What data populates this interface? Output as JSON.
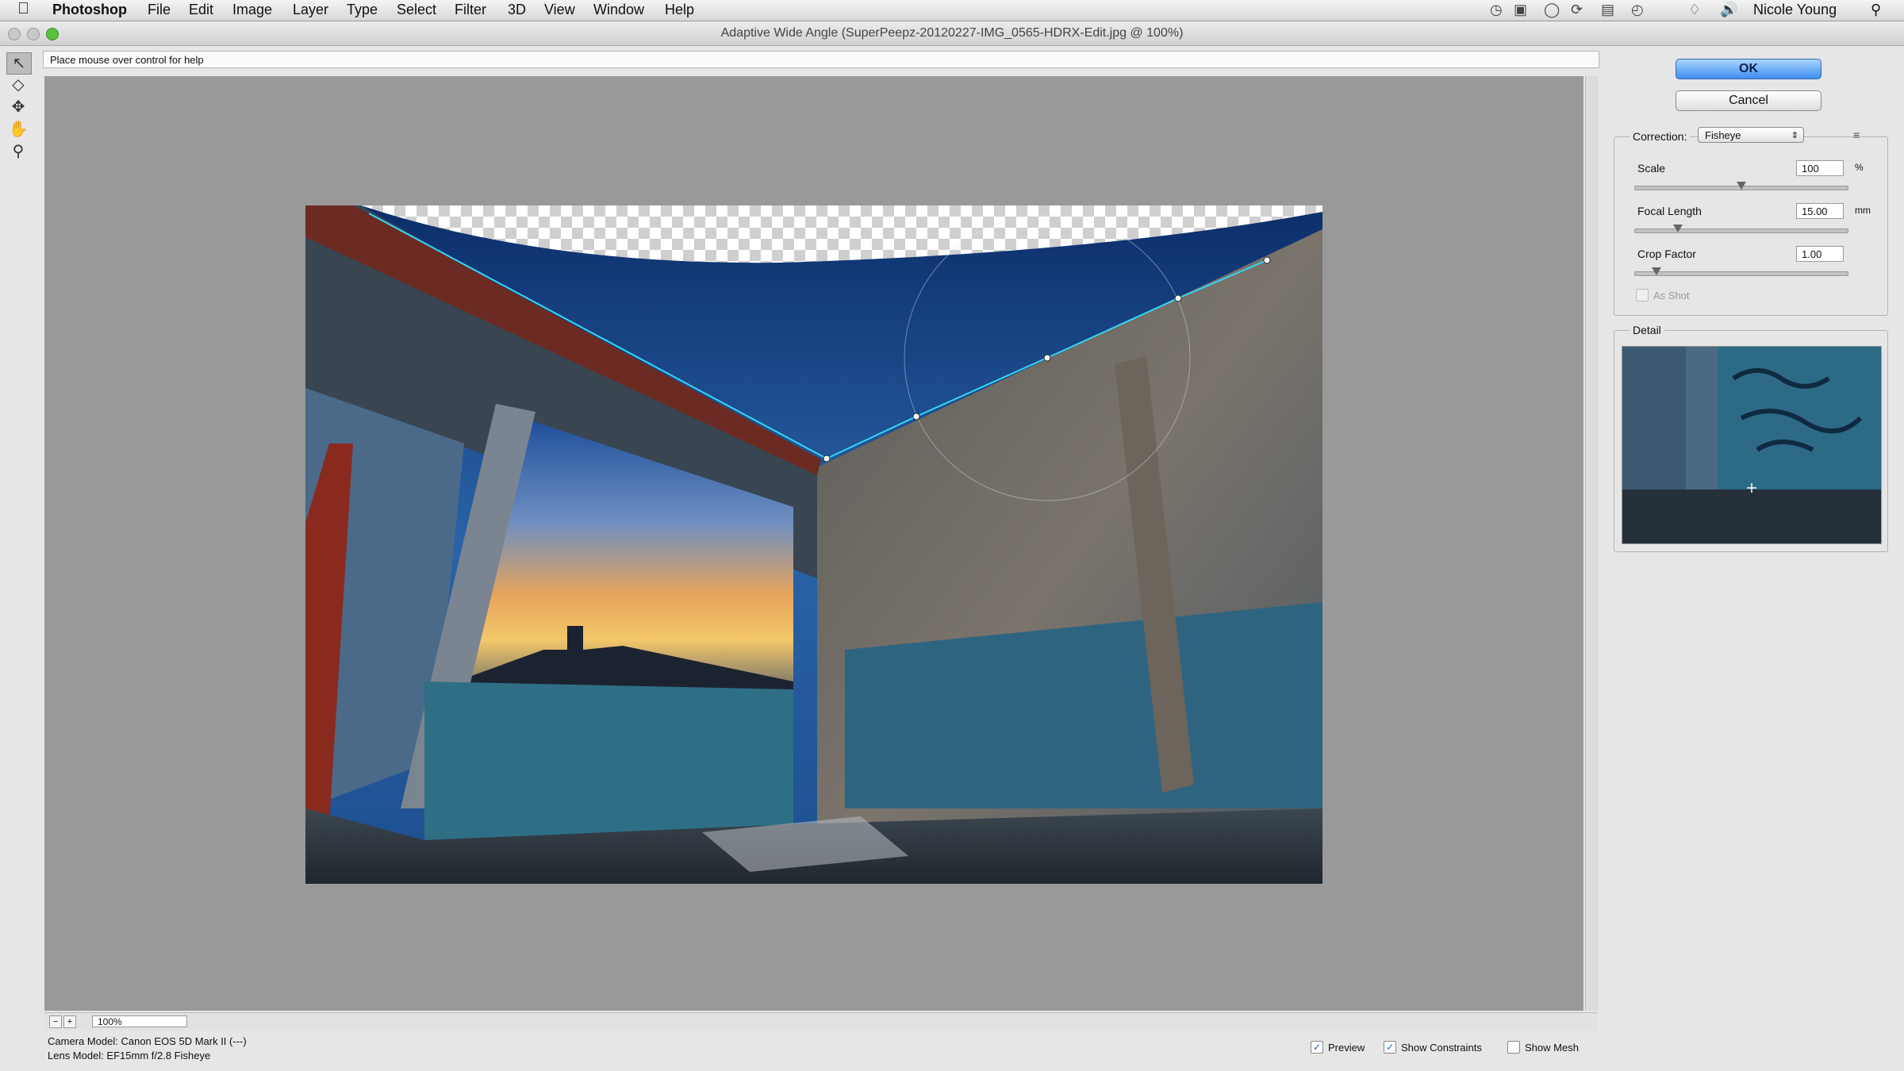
{
  "menubar": {
    "apple": "",
    "app_name": "Photoshop",
    "items": [
      "File",
      "Edit",
      "Image",
      "Layer",
      "Type",
      "Select",
      "Filter",
      "3D",
      "View",
      "Window",
      "Help"
    ],
    "user": "Nicole Young",
    "status_icons": [
      "clock-icon",
      "display-icon",
      "sync-icon",
      "timemachine-icon",
      "wifi-icon",
      "volume-icon",
      "spotlight-icon"
    ]
  },
  "window": {
    "title": "Adaptive Wide Angle (SuperPeepz-20120227-IMG_0565-HDRX-Edit.jpg @ 100%)"
  },
  "help_text": "Place mouse over control for help",
  "tools": [
    "constraint-tool-icon",
    "polygon-constraint-tool-icon",
    "move-tool-icon",
    "hand-tool-icon",
    "zoom-tool-icon"
  ],
  "zoom": {
    "value": "100%"
  },
  "camera_info": {
    "camera": "Camera Model: Canon EOS 5D Mark II (---)",
    "lens": "Lens Model: EF15mm f/2.8 Fisheye"
  },
  "options": {
    "preview": "Preview",
    "preview_checked": true,
    "show_constraints": "Show Constraints",
    "show_constraints_checked": true,
    "show_mesh": "Show Mesh",
    "show_mesh_checked": false
  },
  "buttons": {
    "ok": "OK",
    "cancel": "Cancel"
  },
  "correction": {
    "label": "Correction:",
    "value": "Fisheye",
    "scale_label": "Scale",
    "scale_value": "100",
    "scale_unit": "%",
    "scale_level": 0.5,
    "focal_label": "Focal Length",
    "focal_value": "15.00",
    "focal_unit": "mm",
    "focal_level": 0.2,
    "crop_label": "Crop Factor",
    "crop_value": "1.00",
    "crop_level": 0.1,
    "as_shot": "As Shot"
  },
  "detail": {
    "label": "Detail"
  },
  "colors": {
    "accent": "#3f8ef0",
    "canvas": "#999999",
    "constraint": "#35d6f5"
  }
}
